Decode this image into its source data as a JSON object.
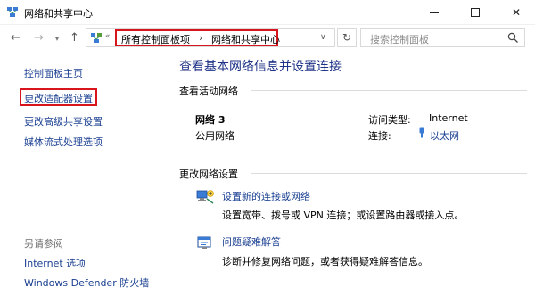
{
  "window": {
    "title": "网络和共享中心",
    "minimize_glyph": "",
    "maximize_glyph": "",
    "close_glyph": "✕"
  },
  "nav": {
    "back_glyph": "←",
    "forward_glyph": "→",
    "dropdown_glyph": "▾",
    "up_glyph": "↑",
    "overflow_glyph": "«",
    "breadcrumb": [
      "所有控制面板项",
      "网络和共享中心"
    ],
    "breadcrumb_sep": "›",
    "address_dropdown_glyph": "∨",
    "refresh_glyph": "↻",
    "search_placeholder": "搜索控制面板"
  },
  "sidebar": {
    "home": "控制面板主页",
    "adapter": "更改适配器设置",
    "advanced_sharing": "更改高级共享设置",
    "media_streaming": "媒体流式处理选项",
    "see_also": "另请参阅",
    "internet_options": "Internet 选项",
    "defender": "Windows Defender 防火墙"
  },
  "main": {
    "title": "查看基本网络信息并设置连接",
    "active_networks_heading": "查看活动网络",
    "network": {
      "name": "网络 3",
      "type": "公用网络",
      "access_label": "访问类型:",
      "access_value": "Internet",
      "connection_label": "连接:",
      "connection_value": "以太网"
    },
    "change_settings_heading": "更改网络设置",
    "tasks": [
      {
        "link": "设置新的连接或网络",
        "desc": "设置宽带、拨号或 VPN 连接；或设置路由器或接入点。"
      },
      {
        "link": "问题疑难解答",
        "desc": "诊断并修复网络问题，或者获得疑难解答信息。"
      }
    ]
  },
  "colors": {
    "link": "#1a3f91",
    "title": "#1e3287",
    "highlight_box": "#d8141c"
  },
  "icons": {
    "app": "network-sharing-center-icon",
    "address": "control-panel-icon",
    "search": "search-icon",
    "ethernet": "ethernet-plug-icon",
    "task1": "new-connection-icon",
    "task2": "troubleshoot-icon"
  }
}
